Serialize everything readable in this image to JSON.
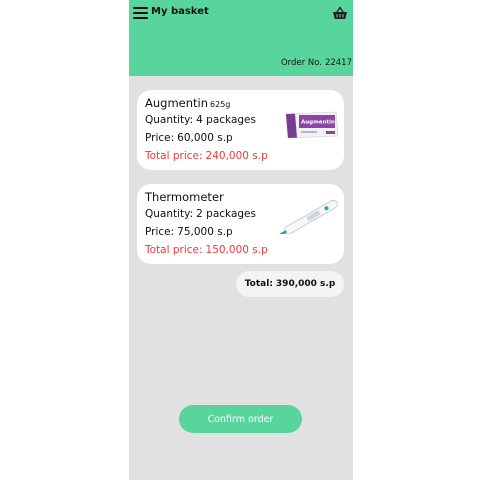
{
  "header": {
    "title": "My basket",
    "order_label": "Order No.",
    "order_number": "22417",
    "menu_icon": "hamburger-menu-icon",
    "basket_icon": "basket-icon"
  },
  "price_label": "Price:",
  "quantity_label": "Quantity:",
  "total_price_label": "Total price:",
  "items": [
    {
      "name": "Augmentin",
      "dose": "625g",
      "quantity": "4 packages",
      "price": "60,000 s.p",
      "total_price": "240,000 s.p",
      "image_icon": "augmentin-box-image",
      "box_text": "Augmentin"
    },
    {
      "name": "Thermometer",
      "quantity": "2 packages",
      "price": "75,000 s.p",
      "total_price": "150,000 s.p",
      "image_icon": "digital-thermometer-image"
    }
  ],
  "total": {
    "label": "Total:",
    "value": "390,000 s.p"
  },
  "confirm_label": "Confirm order",
  "colors": {
    "accent": "#57d59d",
    "background": "#e1e1e1",
    "total_price": "#ea3a3a",
    "card": "#ffffff"
  }
}
